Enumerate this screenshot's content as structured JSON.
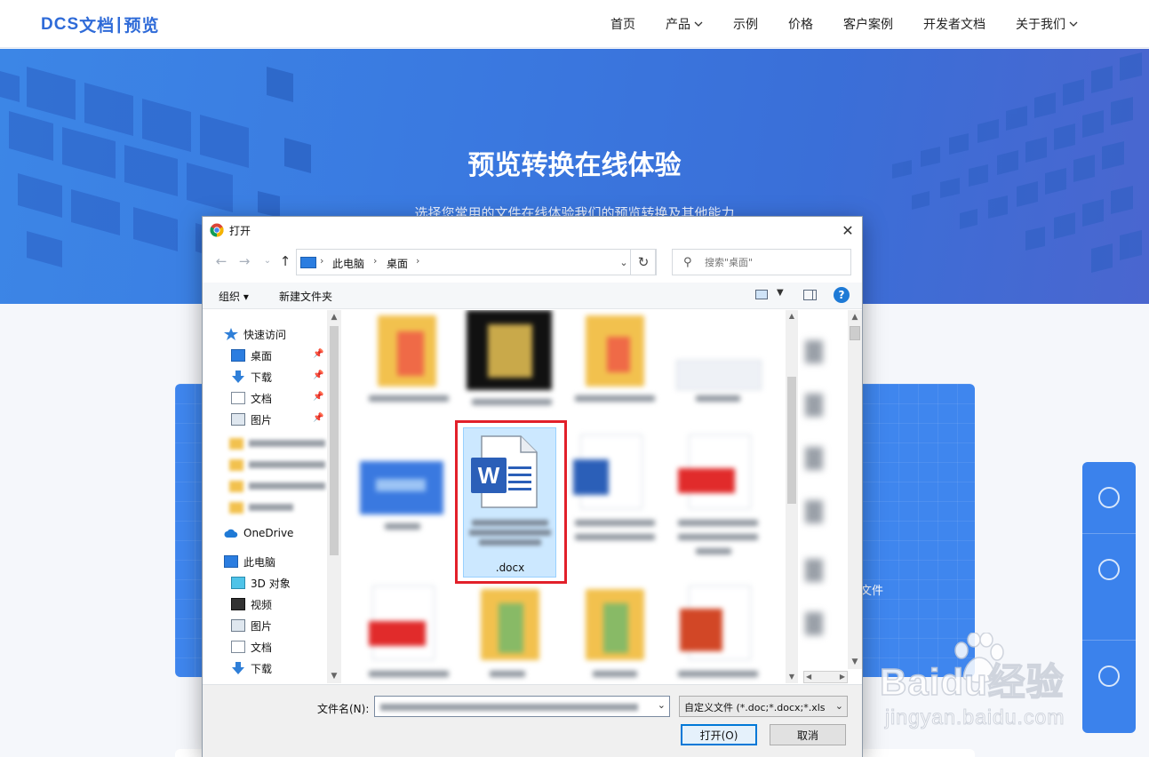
{
  "site": {
    "logo": {
      "part1": "DCS",
      "part2": "文档",
      "sep": "|",
      "part3": "预览"
    },
    "nav": [
      {
        "label": "首页",
        "has_dropdown": false
      },
      {
        "label": "产品",
        "has_dropdown": true
      },
      {
        "label": "示例",
        "has_dropdown": false
      },
      {
        "label": "价格",
        "has_dropdown": false
      },
      {
        "label": "客户案例",
        "has_dropdown": false
      },
      {
        "label": "开发者文档",
        "has_dropdown": false
      },
      {
        "label": "关于我们",
        "has_dropdown": true
      }
    ],
    "hero_title": "预览转换在线体验",
    "hero_subtitle": "选择您常用的文件在线体验我们的预览转换及其他能力",
    "upload_card_text": "文件"
  },
  "dialog": {
    "title": "打开",
    "close_glyph": "✕",
    "address": {
      "segments": [
        "此电脑",
        "桌面"
      ]
    },
    "search_placeholder": "搜索\"桌面\"",
    "toolbar": {
      "organize": "组织",
      "new_folder": "新建文件夹",
      "help": "?"
    },
    "nav_pane": {
      "quick_access": "快速访问",
      "quick_items": [
        "桌面",
        "下载",
        "文档",
        "图片"
      ],
      "onedrive": "OneDrive",
      "this_pc": "此电脑",
      "pc_items": [
        "3D 对象",
        "视频",
        "图片",
        "文档",
        "下载"
      ]
    },
    "selected_file_ext": ".docx",
    "footer": {
      "filename_label": "文件名(N):",
      "filetype": "自定义文件 (*.doc;*.docx;*.xls",
      "open_button": "打开(O)",
      "cancel_button": "取消"
    }
  },
  "watermark": {
    "line1": "Baidu经验",
    "line2": "jingyan.baidu.com"
  },
  "colors": {
    "brand": "#2f6bd8",
    "hero": "#3a79e0",
    "selection": "#cce8ff",
    "highlight": "#e2202a"
  }
}
